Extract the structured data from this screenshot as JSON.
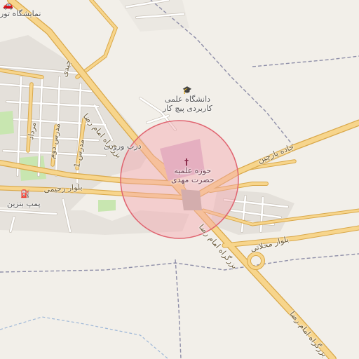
{
  "map": {
    "colors": {
      "background": "#f2efe9",
      "residential": "#e4e0da",
      "park": "#c8e6b0",
      "major_road": "#f7d58c",
      "major_road_casing": "#d9a84a",
      "minor_road": "#ffffff",
      "minor_road_casing": "#c9c2b8",
      "boundary": "#8e8ea8",
      "highlight_fill": "#f3a6ae",
      "highlight_stroke": "#e06470",
      "campus": "#d9b6cf",
      "water_dash": "#9fb8d8"
    },
    "labels": {
      "exhibition": "نمایشگاه تور",
      "university": "دانشگاه علمی\nکاربردی پیچ کار",
      "seminary": "حوزه علمیه\nحضرت مهدی",
      "entrance": "درب ورودی",
      "gas_station": "پمپ بنزین",
      "emam_reza_1": "بزرگراه امام رضا",
      "emam_reza_2": "بزرگراه امام رضا",
      "emam_reza_3": "بزرگراه امام رضا",
      "parchin_road": "جاده پارچین",
      "rahimi_blvd": "بلوار رحیمی",
      "mahallati_blvd": "بلوار محلاتی",
      "jeyedi": "جیدی",
      "mordad": "مرداد",
      "modares": "مدرس دوم",
      "modares_1": "مدرس 1"
    },
    "icons": {
      "car_icon": "car-icon",
      "school_icon": "graduation-cap-icon",
      "religious_icon": "religious-school-icon",
      "fuel_icon": "fuel-pump-icon"
    }
  }
}
